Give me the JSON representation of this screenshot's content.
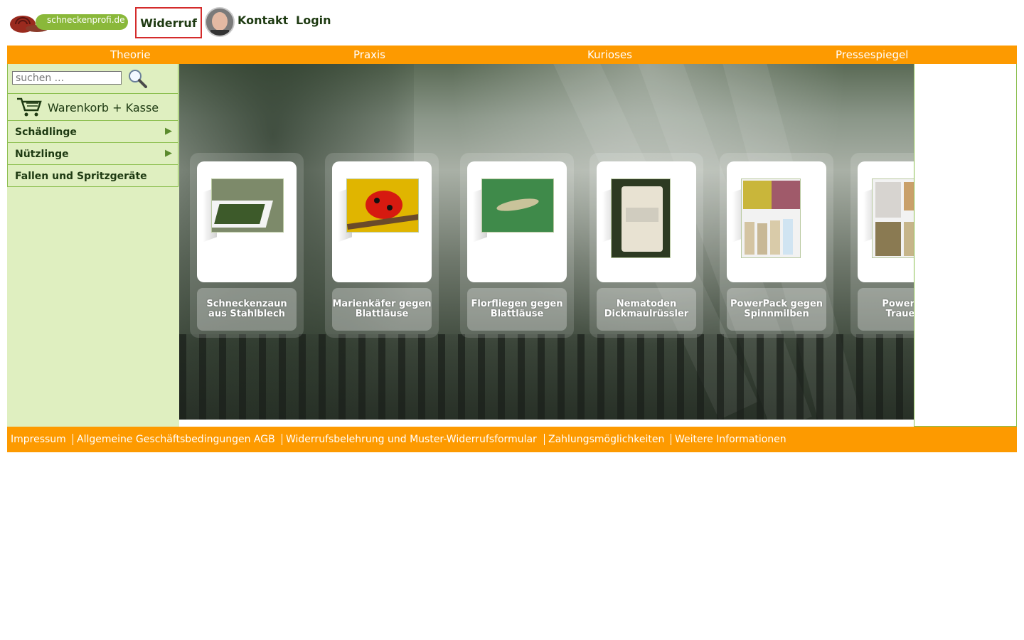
{
  "header": {
    "logo_text": "schneckenprofi.de",
    "widerruf_label": "Widerruf",
    "kontakt_label": "Kontakt",
    "login_label": "Login"
  },
  "mainnav": {
    "items": [
      "Theorie",
      "Praxis",
      "Kurioses",
      "Pressespiegel"
    ]
  },
  "sidebar": {
    "search_placeholder": "suchen ...",
    "cart_label": "Warenkorb + Kasse",
    "menu": [
      {
        "label": "Schädlinge",
        "has_arrow": true
      },
      {
        "label": "Nützlinge",
        "has_arrow": true
      },
      {
        "label": "Fallen und Spritzgeräte",
        "has_arrow": false
      }
    ]
  },
  "products": [
    {
      "line1": "Schneckenzaun",
      "line2": "aus Stahlblech"
    },
    {
      "line1": "Marienkäfer gegen",
      "line2": "Blattläuse"
    },
    {
      "line1": "Florfliegen gegen",
      "line2": "Blattläuse"
    },
    {
      "line1": "Nematoden",
      "line2": "Dickmaulrüssler"
    },
    {
      "line1": "PowerPack gegen",
      "line2": "Spinnmilben"
    },
    {
      "line1": "PowerPac",
      "line2": "Trauerm"
    }
  ],
  "footer": {
    "links": [
      "Impressum",
      "Allgemeine Geschäftsbedingungen AGB",
      "Widerrufsbelehrung und Muster-Widerrufsformular",
      "Zahlungsmöglichkeiten",
      "Weitere Informationen"
    ]
  },
  "colors": {
    "accent_orange": "#fd9a00",
    "sidebar_green": "#dfefc0",
    "text_dark_green": "#1e3a12",
    "widerruf_border": "#d42b2b"
  }
}
